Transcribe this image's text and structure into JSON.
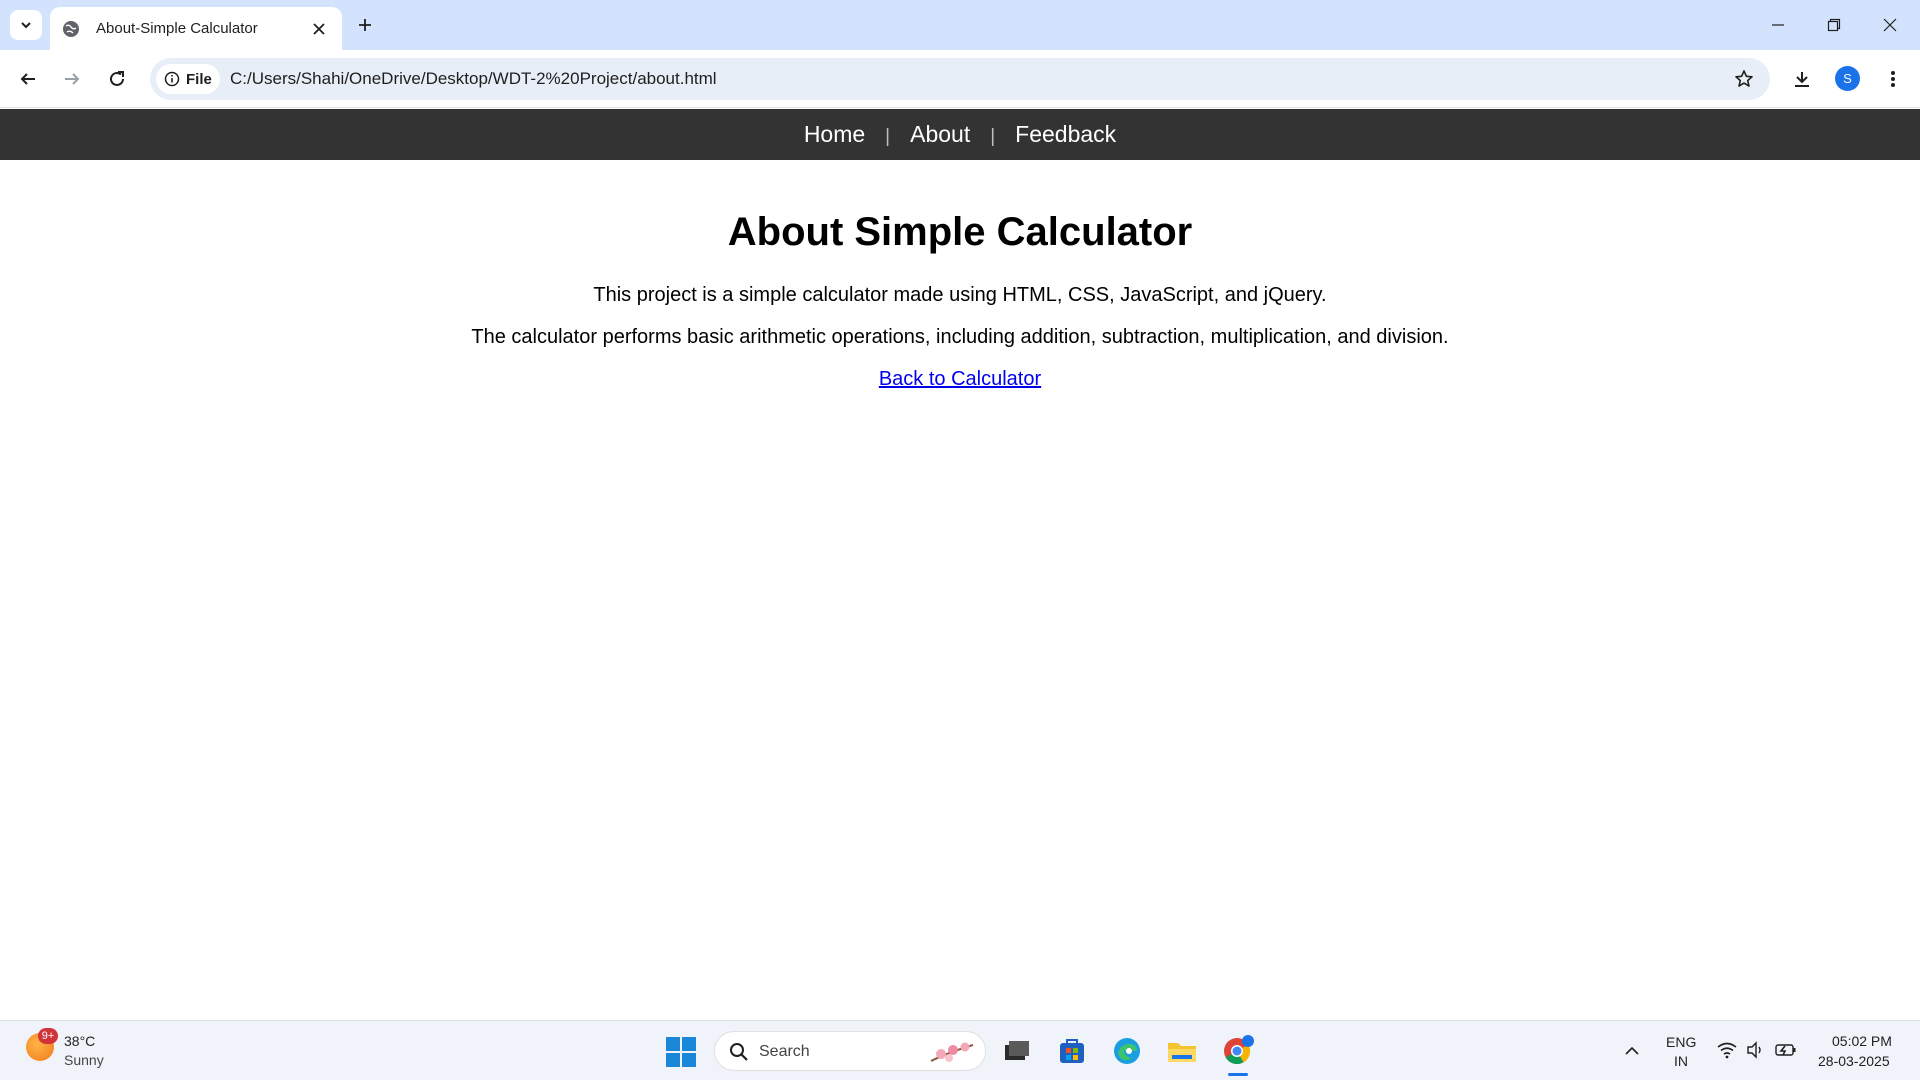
{
  "browser": {
    "tab_title": "About-Simple Calculator",
    "chip_label": "File",
    "url": "C:/Users/Shahi/OneDrive/Desktop/WDT-2%20Project/about.html",
    "profile_initial": "S"
  },
  "page": {
    "nav": {
      "home": "Home",
      "about": "About",
      "feedback": "Feedback",
      "separator": "|"
    },
    "heading": "About Simple Calculator",
    "paragraph1": "This project is a simple calculator made using HTML, CSS, JavaScript, and jQuery.",
    "paragraph2": "The calculator performs basic arithmetic operations, including addition, subtraction, multiplication, and division.",
    "back_link": "Back to Calculator"
  },
  "taskbar": {
    "weather_badge": "9+",
    "temperature": "38°C",
    "condition": "Sunny",
    "search_label": "Search",
    "lang_line1": "ENG",
    "lang_line2": "IN",
    "time": "05:02 PM",
    "date": "28-03-2025"
  },
  "colors": {
    "navbar_bg": "#333333",
    "tabstrip_bg": "#d3e3fd",
    "link_color": "#0000ee"
  }
}
